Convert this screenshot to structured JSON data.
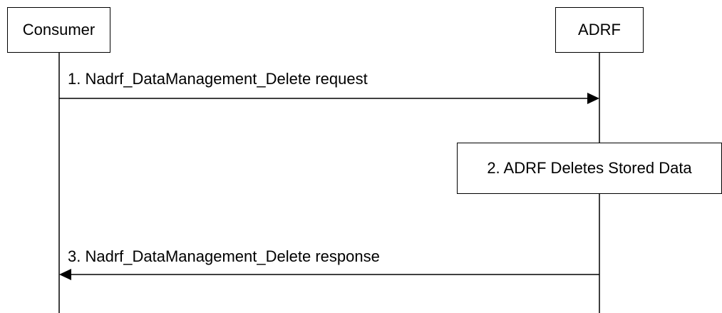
{
  "participants": {
    "consumer": "Consumer",
    "adrf": "ADRF"
  },
  "steps": {
    "step1": "1. Nadrf_DataManagement_Delete request",
    "step2": "2. ADRF Deletes Stored Data",
    "step3": "3. Nadrf_DataManagement_Delete response"
  },
  "colors": {
    "line": "#000000",
    "background": "#ffffff"
  }
}
